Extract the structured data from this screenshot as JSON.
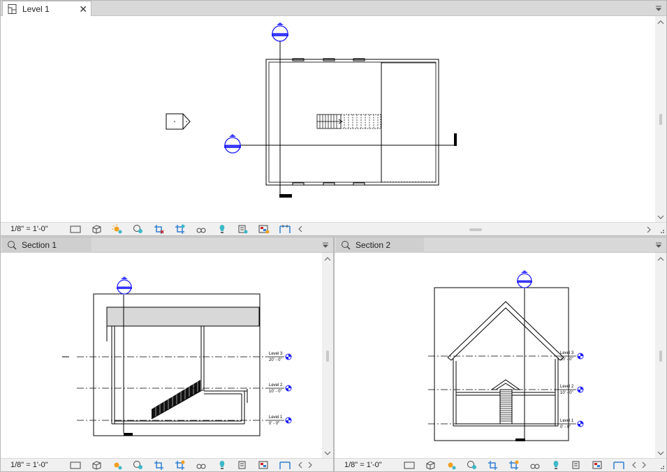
{
  "views": {
    "level1": {
      "tab_label": "Level 1",
      "close_glyph": "✕",
      "scale": "1/8\" = 1'-0\""
    },
    "section1": {
      "tab_label": "Section 1",
      "scale": "1/8\" = 1'-0\""
    },
    "section2": {
      "tab_label": "Section 2",
      "scale": "1/8\" = 1'-0\""
    }
  },
  "levels": [
    {
      "name": "Level 3",
      "elevation": "20' - 0\""
    },
    {
      "name": "Level 2",
      "elevation": "10' - 0\""
    },
    {
      "name": "Level 1",
      "elevation": "0' - 0\""
    }
  ],
  "view_control_icons": [
    "detail-level-icon",
    "visual-style-icon",
    "sun-path-icon",
    "shadows-icon",
    "crop-view-icon",
    "show-crop-region-icon",
    "temporary-hide-isolate-icon",
    "reveal-hidden-elements-icon",
    "temporary-view-properties-icon",
    "worksharing-display-icon",
    "analytical-model-icon"
  ],
  "colors": {
    "accent_blue": "#1a1aff",
    "icon_blue": "#2f7fd1",
    "icon_teal": "#3cb8c8",
    "icon_orange": "#f0a020",
    "icon_red": "#d02020"
  }
}
